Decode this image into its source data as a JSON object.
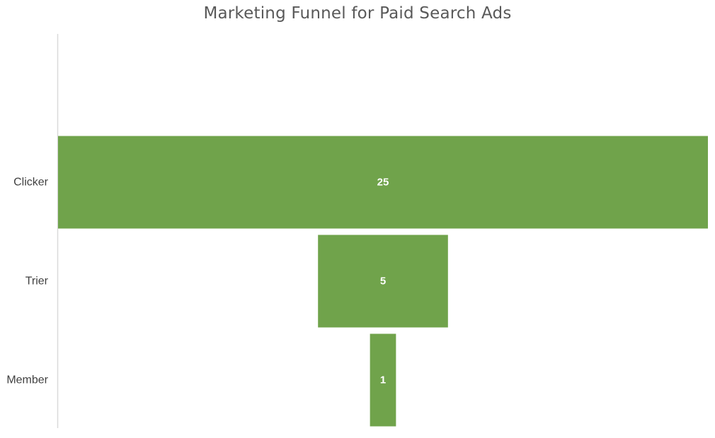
{
  "chart_data": {
    "type": "bar",
    "subtype": "funnel",
    "title": "Marketing Funnel for Paid Search Ads",
    "categories": [
      "Clicker",
      "Trier",
      "Member"
    ],
    "values": [
      25,
      5,
      1
    ],
    "data_labels": [
      "25",
      "5",
      "1"
    ],
    "orientation": "horizontal",
    "color": "#70A34B",
    "grid": false,
    "legend": "none"
  }
}
